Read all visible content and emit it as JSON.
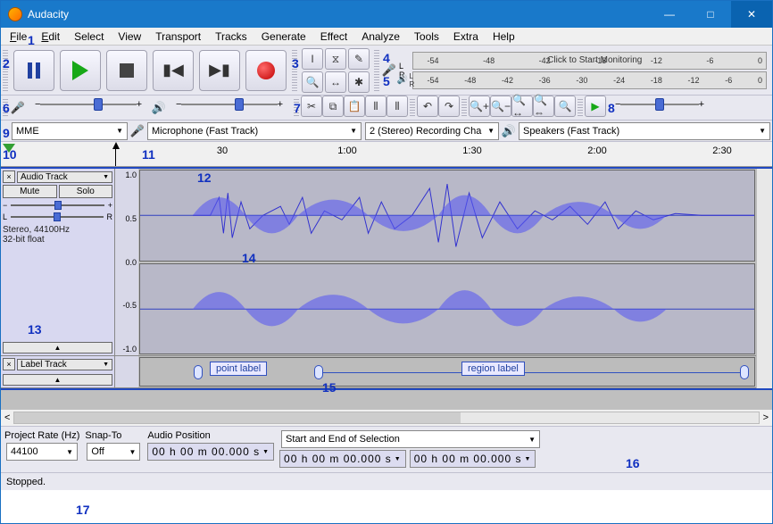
{
  "window": {
    "title": "Audacity"
  },
  "menu": {
    "file": "File",
    "edit": "Edit",
    "select": "Select",
    "view": "View",
    "transport": "Transport",
    "tracks": "Tracks",
    "generate": "Generate",
    "effect": "Effect",
    "analyze": "Analyze",
    "tools": "Tools",
    "extra": "Extra",
    "help": "Help"
  },
  "meters": {
    "rec_ticks": [
      "-54",
      "-48",
      "-42"
    ],
    "rec_msg": "Click to Start Monitoring",
    "rec_ticks2": [
      "-18",
      "-12",
      "-6",
      "0"
    ],
    "play_ticks": [
      "-54",
      "-48",
      "-42",
      "-36",
      "-30",
      "-24",
      "-18",
      "-12",
      "-6",
      "0"
    ]
  },
  "device": {
    "host": "MME",
    "input": "Microphone (Fast Track)",
    "channels": "2 (Stereo) Recording Cha",
    "output": "Speakers (Fast Track)"
  },
  "timeline": {
    "t1": "30",
    "t2": "1:00",
    "t3": "1:30",
    "t4": "2:00",
    "t5": "2:30"
  },
  "track": {
    "name": "Audio Track",
    "mute": "Mute",
    "solo": "Solo",
    "info1": "Stereo, 44100Hz",
    "info2": "32-bit float",
    "scale_top": "1.0",
    "scale_hi": "0.5",
    "scale_mid": "0.0",
    "scale_lo": "-0.5",
    "scale_bot": "-1.0"
  },
  "labeltrack": {
    "name": "Label Track",
    "point": "point label",
    "region": "region label"
  },
  "selection": {
    "rate_label": "Project Rate (Hz)",
    "rate": "44100",
    "snap_label": "Snap-To",
    "snap": "Off",
    "pos_label": "Audio Position",
    "pos": "00 h 00 m 00.000 s",
    "range_label": "Start and End of Selection",
    "start": "00 h 00 m 00.000 s",
    "end": "00 h 00 m 00.000 s"
  },
  "status": {
    "text": "Stopped."
  },
  "annot": {
    "a1": "1",
    "a2": "2",
    "a3": "3",
    "a4": "4",
    "a5": "5",
    "a6": "6",
    "a7": "7",
    "a8": "8",
    "a9": "9",
    "a10": "10",
    "a11": "11",
    "a12": "12",
    "a13": "13",
    "a14": "14",
    "a15": "15",
    "a16": "16",
    "a17": "17"
  }
}
